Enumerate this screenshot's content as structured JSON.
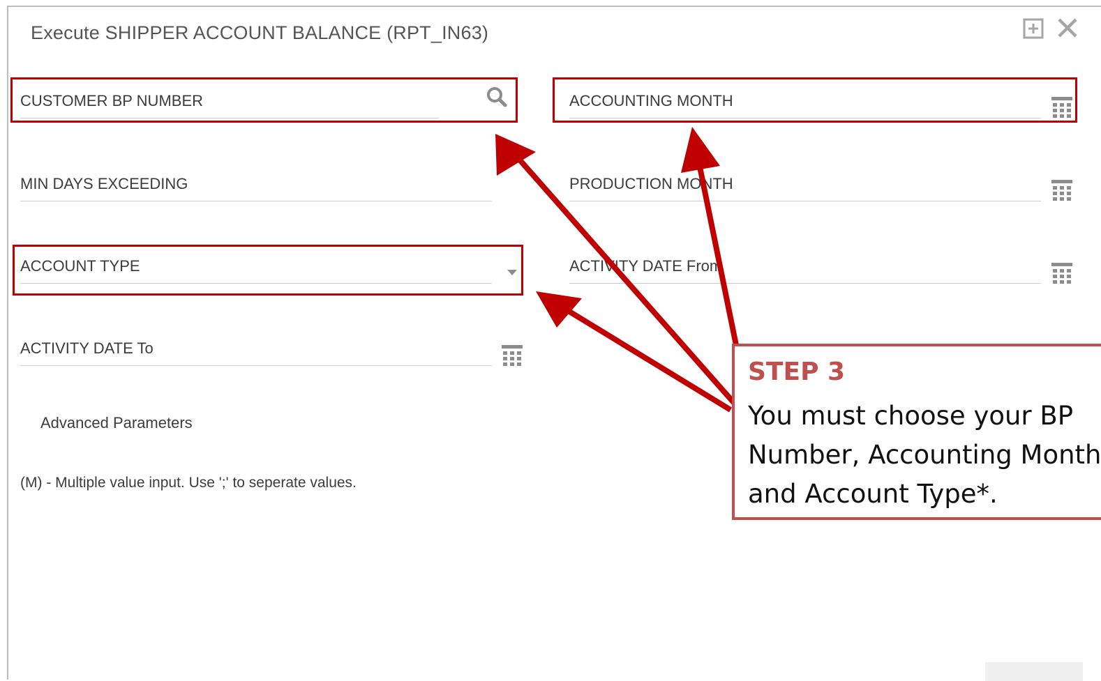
{
  "dialog": {
    "title": "Execute SHIPPER ACCOUNT BALANCE (RPT_IN63)",
    "maximize_icon": "maximize-icon",
    "close_icon": "close-icon"
  },
  "fields": {
    "customer_bp_number": {
      "label": "CUSTOMER BP NUMBER",
      "icon": "search-icon",
      "value": ""
    },
    "accounting_month": {
      "label": "ACCOUNTING MONTH",
      "icon": "calendar-icon",
      "value": ""
    },
    "min_days_exceeding": {
      "label": "MIN DAYS EXCEEDING",
      "value": ""
    },
    "production_month": {
      "label": "PRODUCTION MONTH",
      "icon": "calendar-icon",
      "value": ""
    },
    "account_type": {
      "label": "ACCOUNT TYPE",
      "icon": "dropdown-arrow-icon",
      "value": ""
    },
    "activity_date_from": {
      "label": "ACTIVITY DATE From",
      "icon": "calendar-icon",
      "value": ""
    },
    "activity_date_to": {
      "label": "ACTIVITY DATE To",
      "icon": "calendar-icon",
      "value": ""
    }
  },
  "advanced_parameters": "Advanced Parameters",
  "help_note": "(M) - Multiple value input. Use ';' to seperate values.",
  "callout": {
    "heading": "STEP 3",
    "line1": "You must choose your BP",
    "line2": "Number, Accounting Month",
    "line3": "and Account Type*."
  },
  "colors": {
    "highlight": "#c00000",
    "callout_border": "#c0504d",
    "arrow": "#c00000"
  }
}
